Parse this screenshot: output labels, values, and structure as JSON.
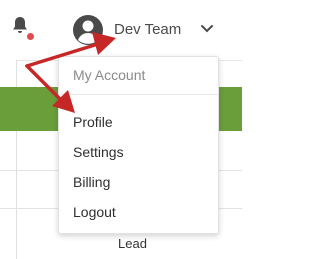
{
  "header": {
    "user_name": "Dev Team",
    "icons": {
      "notifications": "bell-icon",
      "avatar": "user-avatar-icon",
      "dropdown": "chevron-down-icon"
    },
    "notification_dot_color": "#e14b4b"
  },
  "menu": {
    "header": "My Account",
    "items": [
      {
        "label": "Profile"
      },
      {
        "label": "Settings"
      },
      {
        "label": "Billing"
      },
      {
        "label": "Logout"
      }
    ]
  },
  "background": {
    "green_bar_color": "#6a9e3b",
    "cell_text": "Lead"
  },
  "annotations": {
    "arrow_color": "#c62828",
    "arrow_targets": [
      "user-name",
      "menu-item-profile"
    ]
  }
}
